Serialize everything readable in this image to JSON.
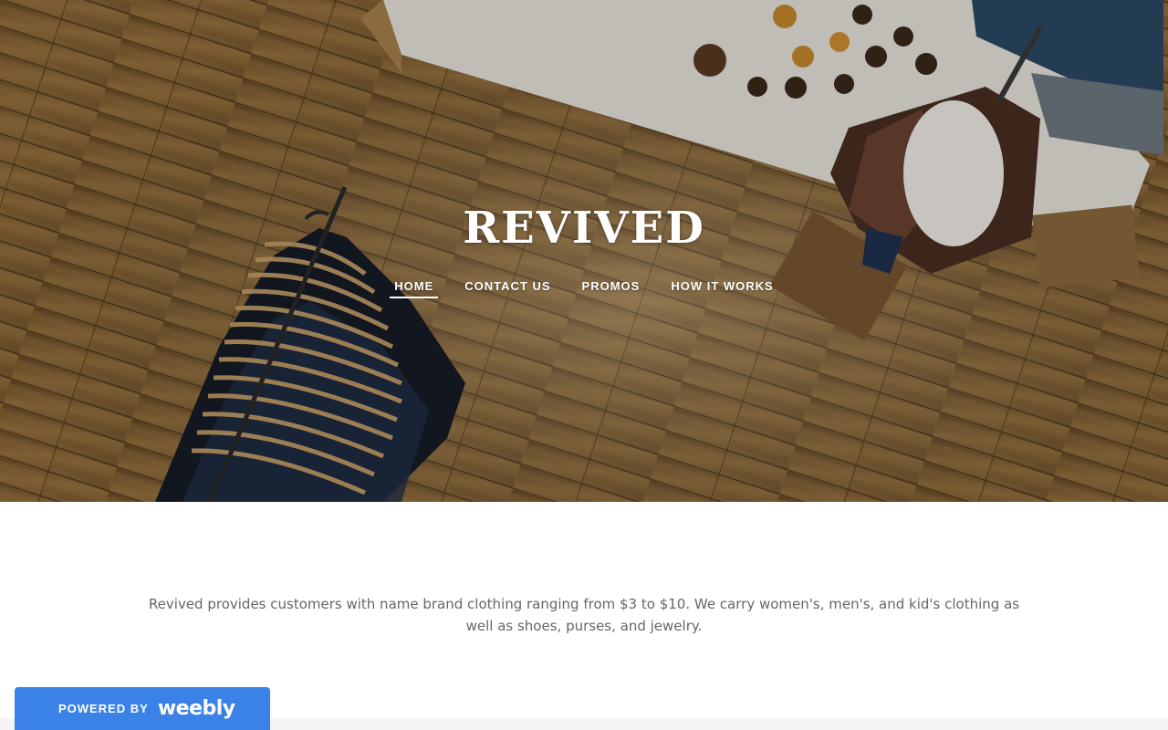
{
  "site": {
    "title": "REVIVED"
  },
  "nav": {
    "items": [
      {
        "label": "HOME",
        "active": true
      },
      {
        "label": "CONTACT US",
        "active": false
      },
      {
        "label": "PROMOS",
        "active": false
      },
      {
        "label": "HOW IT WORKS",
        "active": false
      }
    ]
  },
  "hero": {
    "image": "overhead-shop-floor-clothing-rack-photo"
  },
  "main": {
    "intro_text": "Revived provides customers with name brand clothing ranging from $3 to $10. We carry women's, men's, and kid's clothing as well as shoes, purses, and jewelry."
  },
  "badge": {
    "powered_by": "POWERED BY",
    "brand": "weebly",
    "color": "#3b82e8"
  },
  "colors": {
    "body_text": "#666666",
    "nav_text": "#ffffff",
    "footer_band": "#f5f5f5"
  }
}
